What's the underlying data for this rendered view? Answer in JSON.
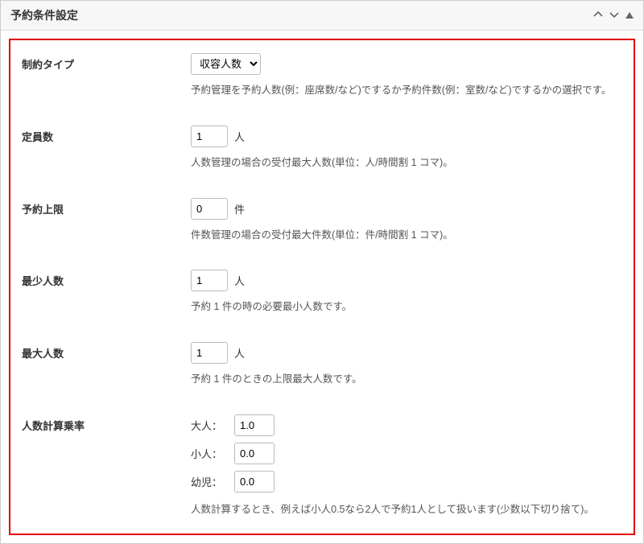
{
  "panel": {
    "title": "予約条件設定"
  },
  "fields": {
    "constraintType": {
      "label": "制約タイプ",
      "value": "収容人数",
      "desc": "予約管理を予約人数(例：座席数/など)でするか予約件数(例：室数/など)でするかの選択です。"
    },
    "capacity": {
      "label": "定員数",
      "value": "1",
      "unit": "人",
      "desc": "人数管理の場合の受付最大人数(単位：人/時間割 1 コマ)。"
    },
    "maxBookings": {
      "label": "予約上限",
      "value": "0",
      "unit": "件",
      "desc": "件数管理の場合の受付最大件数(単位：件/時間割 1 コマ)。"
    },
    "minPeople": {
      "label": "最少人数",
      "value": "1",
      "unit": "人",
      "desc": "予約 1 件の時の必要最小人数です。"
    },
    "maxPeople": {
      "label": "最大人数",
      "value": "1",
      "unit": "人",
      "desc": "予約 1 件のときの上限最大人数です。"
    },
    "rates": {
      "label": "人数計算乗率",
      "adultLabel": "大人：",
      "adult": "1.0",
      "childLabel": "小人：",
      "child": "0.0",
      "infantLabel": "幼児：",
      "infant": "0.0",
      "desc": "人数計算するとき、例えば小人0.5なら2人で予約1人として扱います(少数以下切り捨て)。"
    }
  }
}
